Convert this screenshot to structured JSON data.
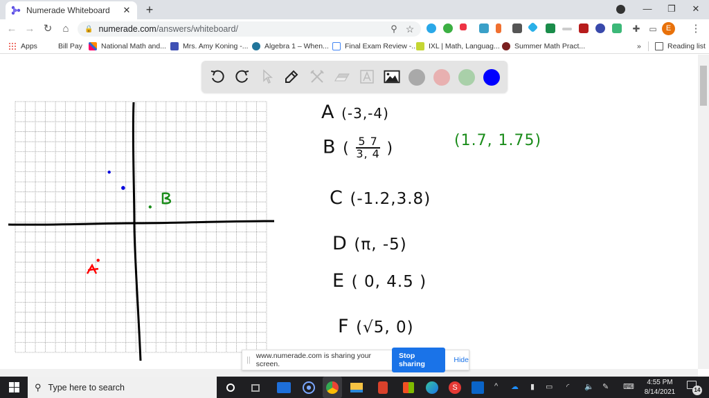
{
  "browser": {
    "tab_title": "Numerade Whiteboard",
    "tab_close": "✕",
    "new_tab": "+",
    "url_host": "numerade.com",
    "url_path": "/answers/whiteboard/",
    "window_controls": {
      "minimize": "—",
      "restore": "❐",
      "close": "✕"
    }
  },
  "bookmarks": [
    {
      "label": "Apps",
      "icon": "apps-grid-icon",
      "color": "#e94235"
    },
    {
      "label": "Bill Pay",
      "icon": "",
      "color": ""
    },
    {
      "label": "National Math and...",
      "icon": "national-math-icon",
      "color": "#3b5bdb"
    },
    {
      "label": "Mrs. Amy Koning -...",
      "icon": "calendar-icon",
      "color": "#3f51b5"
    },
    {
      "label": "Algebra 1 – When...",
      "icon": "wordpress-icon",
      "color": "#21759b"
    },
    {
      "label": "Final Exam Review -...",
      "icon": "doc-icon",
      "color": "#4285f4"
    },
    {
      "label": "IXL | Math, Languag...",
      "icon": "ixl-icon",
      "color": "#c5d633"
    },
    {
      "label": "Summer Math Pract...",
      "icon": "summer-math-icon",
      "color": "#7a1f1f"
    }
  ],
  "bookmarks_overflow": "»",
  "reading_list": "Reading list",
  "whiteboard": {
    "tools": [
      "undo",
      "redo",
      "select",
      "pen",
      "tools",
      "eraser",
      "text",
      "image"
    ],
    "colors": [
      {
        "name": "gray",
        "hex": "#a9a9a9"
      },
      {
        "name": "pink",
        "hex": "#e8b0b0"
      },
      {
        "name": "light-green",
        "hex": "#a9d0a9"
      },
      {
        "name": "blue",
        "hex": "#0000ff",
        "selected": true
      }
    ]
  },
  "notes": {
    "lines": [
      {
        "letter": "A",
        "coords": "(-3,-4)"
      },
      {
        "letter": "B",
        "coords": "(5/3, 7/4)",
        "numerator": "5   7",
        "denominator": "3,  4",
        "decimal": "(1.7, 1.75)"
      },
      {
        "letter": "C",
        "coords": "(-1.2,3.8)"
      },
      {
        "letter": "D",
        "coords": "(π, -5)"
      },
      {
        "letter": "E",
        "coords": "( 0, 4.5 )"
      },
      {
        "letter": "F",
        "coords": "(√5, 0)"
      }
    ]
  },
  "graph": {
    "grid_cells": 25,
    "points": [
      {
        "label": "A",
        "x": -3,
        "y": -4,
        "color": "#ff0000"
      },
      {
        "label": "B",
        "x": 1.7,
        "y": 1.75,
        "color": "#1a8c1a"
      },
      {
        "label": "",
        "x": -2.7,
        "y": 5.5,
        "color": "#0000dd"
      },
      {
        "label": "",
        "x": -1.2,
        "y": 3.8,
        "color": "#0000dd"
      }
    ],
    "graph_labels": {
      "A": "A",
      "B": "B"
    }
  },
  "share_banner": {
    "message": "www.numerade.com is sharing your screen.",
    "stop_label": "Stop sharing",
    "hide_label": "Hide"
  },
  "taskbar": {
    "search_placeholder": "Type here to search",
    "time": "4:55 PM",
    "date": "8/14/2021",
    "notification_count": "14"
  }
}
